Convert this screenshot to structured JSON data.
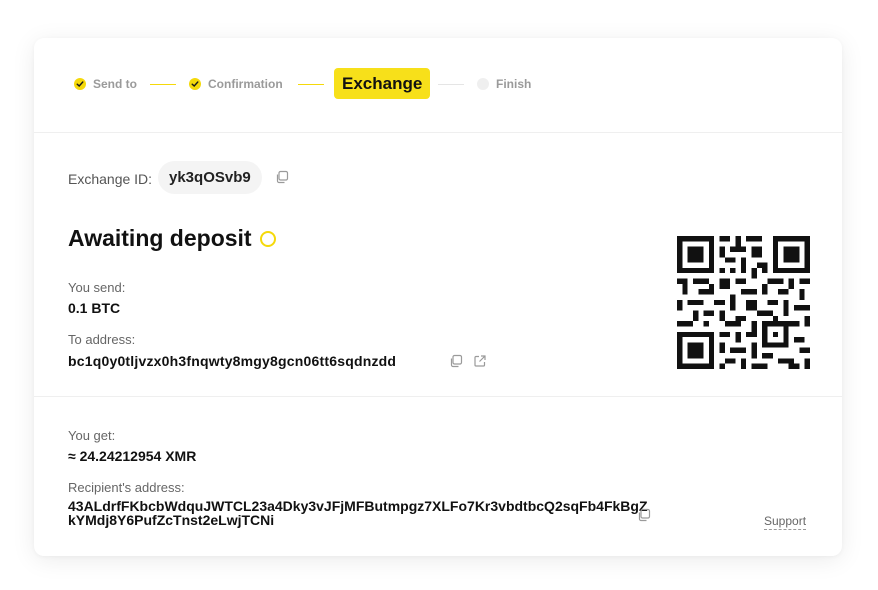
{
  "stepper": {
    "steps": [
      {
        "label": "Send to",
        "state": "done"
      },
      {
        "label": "Confirmation",
        "state": "done"
      },
      {
        "label": "Exchange",
        "state": "active"
      },
      {
        "label": "Finish",
        "state": "pending"
      }
    ]
  },
  "exchange": {
    "id_label": "Exchange ID:",
    "id_value": "yk3qOSvb9",
    "status_title": "Awaiting deposit",
    "send_label": "You send:",
    "send_value": "0.1 BTC",
    "to_label": "To address:",
    "to_value": "bc1q0y0tljvzx0h3fnqwty8mgy8gcn06tt6sqdnzdd",
    "get_label": "You get:",
    "get_value": "≈ 24.24212954 XMR",
    "recipient_label": "Recipient's address:",
    "recipient_value": "43ALdrfFKbcbWdquJWTCL23a4Dky3vJFjMFButmpgz7XLFo7Kr3vbdtbcQ2sqFb4FkBgZkYMdj8Y6PufZcTnst2eLwjTCNi",
    "support_label": "Support"
  },
  "colors": {
    "accent": "#f7e01a",
    "muted": "#9a9a9a"
  },
  "icons": [
    "check-icon",
    "dot-icon",
    "copy-icon",
    "external-link-icon",
    "spinner-icon",
    "qr-code"
  ]
}
